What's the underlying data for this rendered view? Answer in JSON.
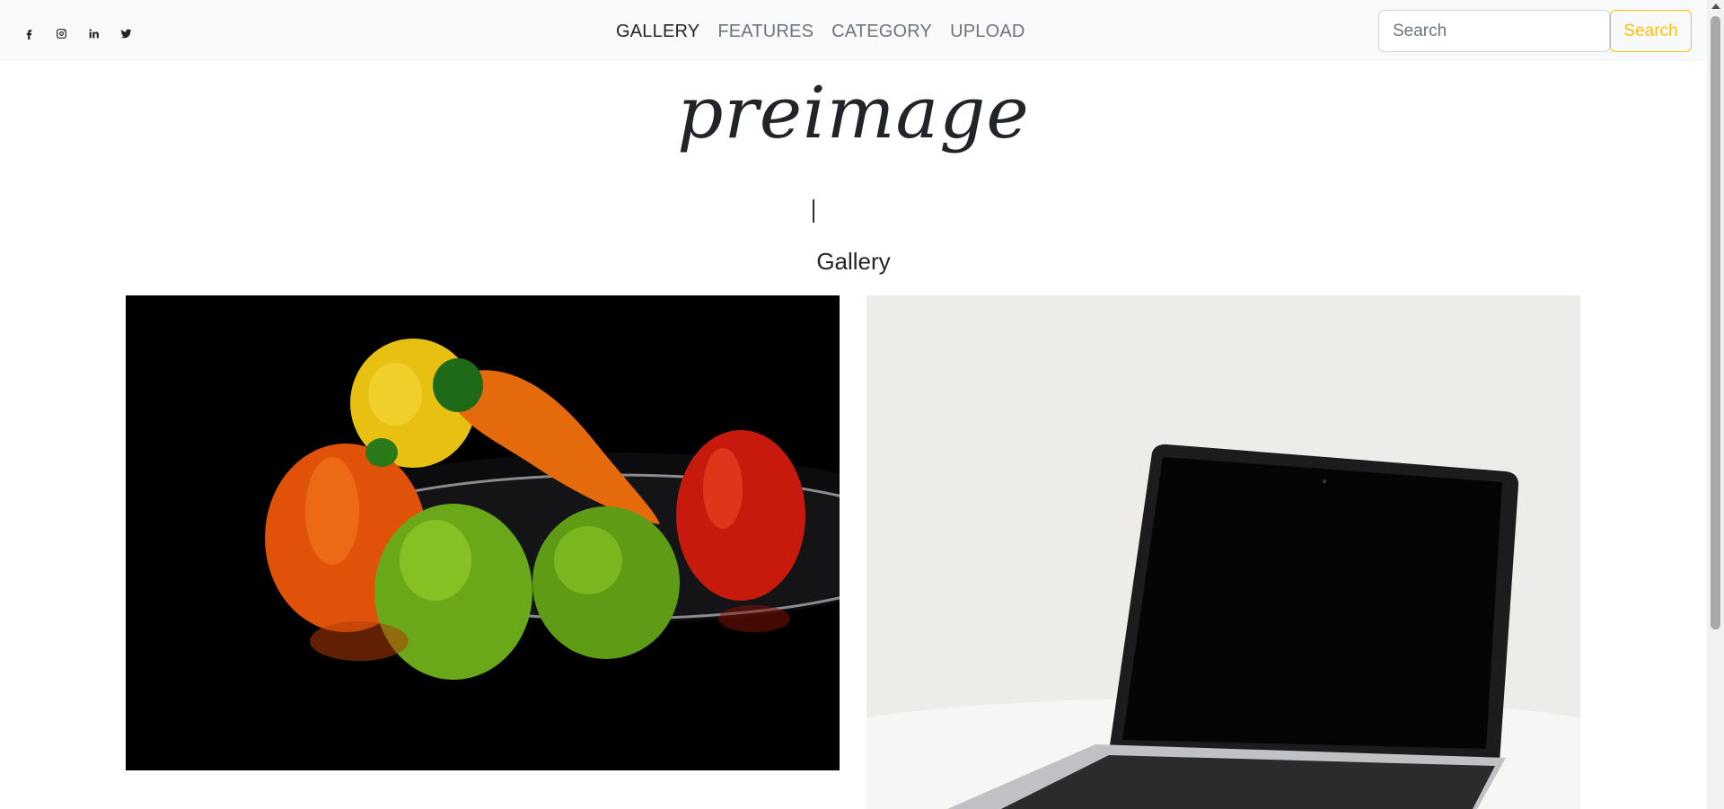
{
  "nav": {
    "social": [
      {
        "name": "facebook-icon",
        "glyph": "f"
      },
      {
        "name": "instagram-icon",
        "glyph": "ig"
      },
      {
        "name": "linkedin-icon",
        "glyph": "in"
      },
      {
        "name": "twitter-icon",
        "glyph": "tw"
      }
    ],
    "links": [
      "GALLERY",
      "FEATURES",
      "CATEGORY",
      "UPLOAD"
    ],
    "active_link": "GALLERY",
    "search": {
      "placeholder": "Search",
      "value": "",
      "button_label": "Search"
    }
  },
  "brand": {
    "name": "preimage"
  },
  "page": {
    "section_title": "Gallery"
  },
  "gallery": [
    {
      "subject": "peppers-and-limes-on-plate"
    },
    {
      "subject": "laptop-on-white-table"
    }
  ],
  "colors": {
    "accent": "#ffc107",
    "navbar_bg": "#f8f9fa",
    "text": "#212529",
    "muted": "#6c757d"
  }
}
